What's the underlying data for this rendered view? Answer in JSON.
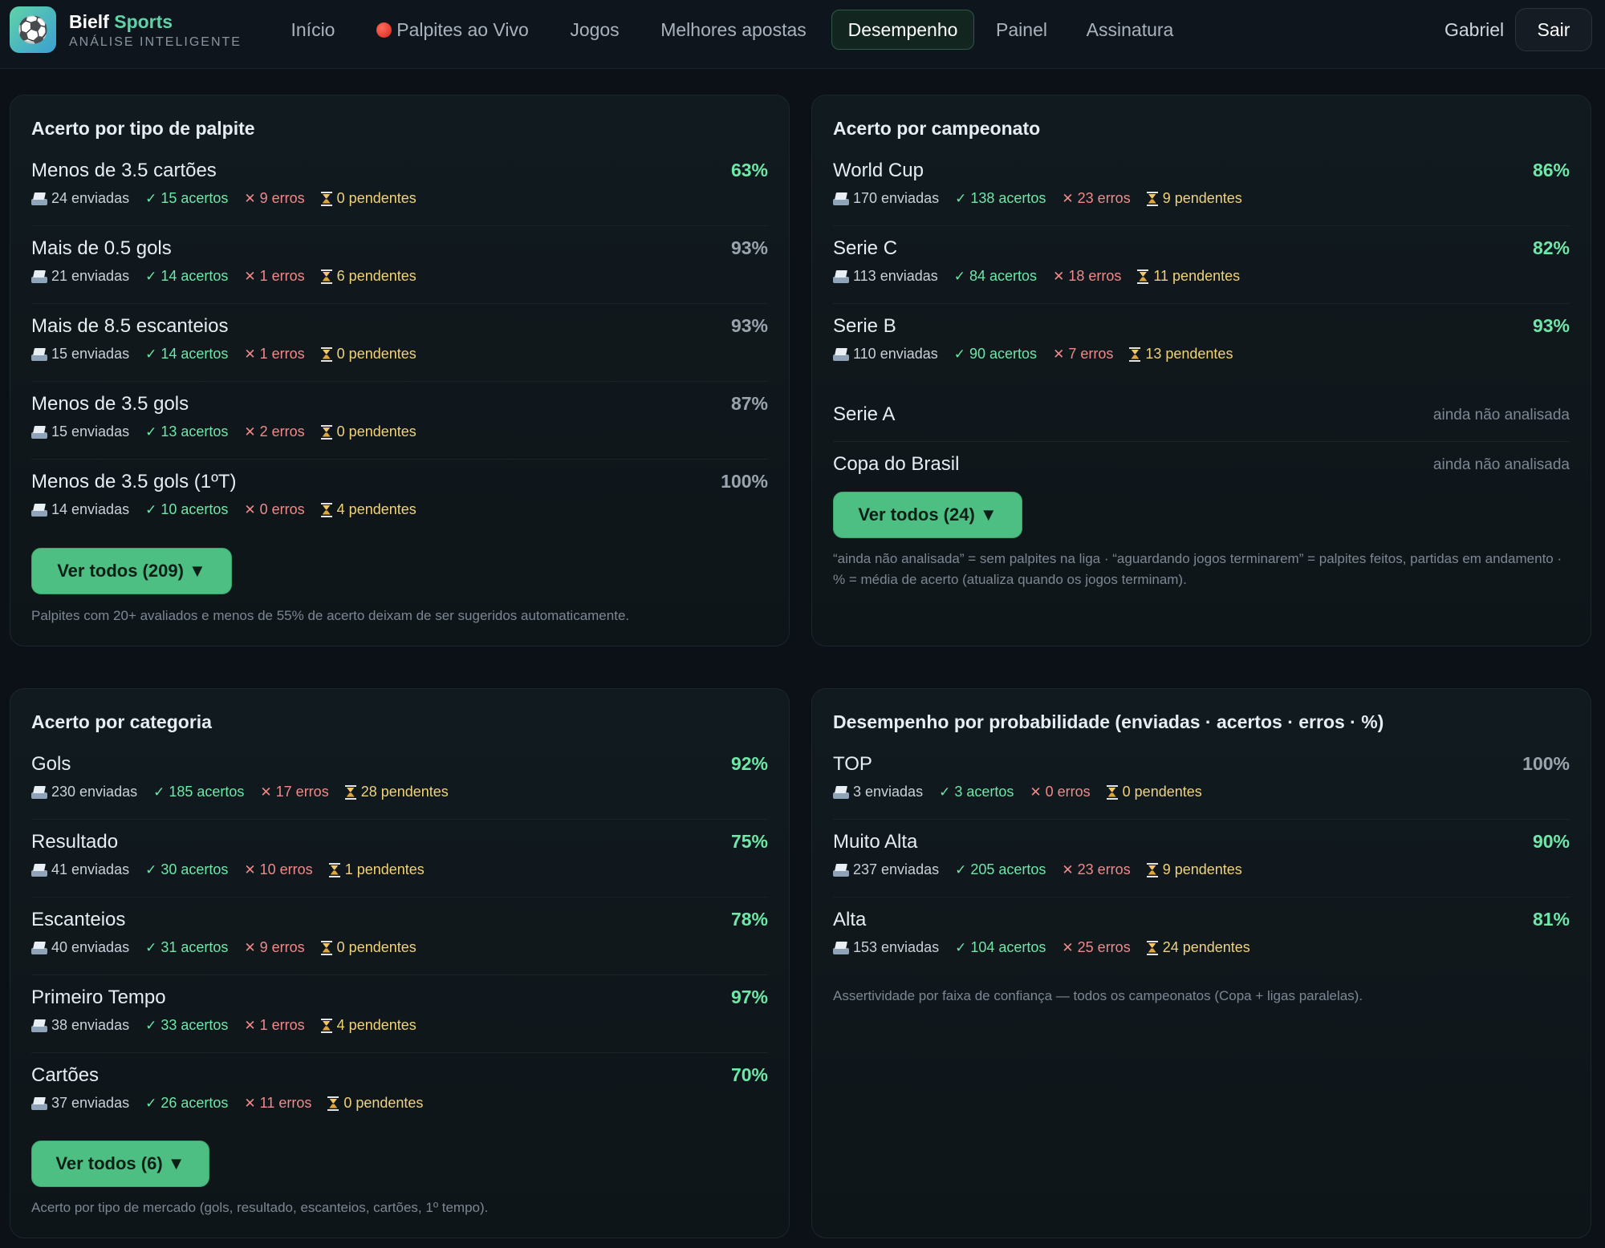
{
  "brand": {
    "logo_icon": "soccer-ball-icon",
    "name_part1": "Bielf",
    "name_part2": "Sports",
    "tagline": "ANÁLISE INTELIGENTE"
  },
  "nav": {
    "items": [
      {
        "label": "Início"
      },
      {
        "label": "Palpites ao Vivo",
        "icon": "live-red-dot-icon"
      },
      {
        "label": "Jogos"
      },
      {
        "label": "Melhores apostas"
      },
      {
        "label": "Desempenho",
        "active": true
      },
      {
        "label": "Painel"
      },
      {
        "label": "Assinatura"
      }
    ],
    "user": "Gabriel",
    "logout": "Sair"
  },
  "colors": {
    "accent_green": "#6ee7a8",
    "button_green": "#4ebf82",
    "miss_red": "#f08a8a",
    "pending_yellow": "#f0d27a",
    "background": "#0b1117"
  },
  "panels": {
    "tipo": {
      "title": "Acerto por tipo de palpite",
      "rows": [
        {
          "name": "Menos de 3.5 cartões",
          "pct": "63%",
          "sent": "24 enviadas",
          "hit": "15 acertos",
          "miss": "9 erros",
          "pend": "0 pendentes"
        },
        {
          "name": "Mais de 0.5 gols",
          "pct": "93%",
          "sent": "21 enviadas",
          "hit": "14 acertos",
          "miss": "1 erros",
          "pend": "6 pendentes"
        },
        {
          "name": "Mais de 8.5 escanteios",
          "pct": "93%",
          "sent": "15 enviadas",
          "hit": "14 acertos",
          "miss": "1 erros",
          "pend": "0 pendentes"
        },
        {
          "name": "Menos de 3.5 gols",
          "pct": "87%",
          "sent": "15 enviadas",
          "hit": "13 acertos",
          "miss": "2 erros",
          "pend": "0 pendentes"
        },
        {
          "name": "Menos de 3.5 gols (1ºT)",
          "pct": "100%",
          "sent": "14 enviadas",
          "hit": "10 acertos",
          "miss": "0 erros",
          "pend": "4 pendentes"
        }
      ],
      "button": "Ver todos (209) ▼",
      "note": "Palpites com 20+ avaliados e menos de 55% de acerto deixam de ser sugeridos automaticamente."
    },
    "campeonato": {
      "title": "Acerto por campeonato",
      "rows": [
        {
          "name": "World Cup",
          "pct": "86%",
          "sent": "170 enviadas",
          "hit": "138 acertos",
          "miss": "23 erros",
          "pend": "9 pendentes"
        },
        {
          "name": "Serie C",
          "pct": "82%",
          "sent": "113 enviadas",
          "hit": "84 acertos",
          "miss": "18 erros",
          "pend": "11 pendentes"
        },
        {
          "name": "Serie B",
          "pct": "93%",
          "sent": "110 enviadas",
          "hit": "90 acertos",
          "miss": "7 erros",
          "pend": "13 pendentes"
        }
      ],
      "unanalyzed": [
        {
          "name": "Serie A",
          "status": "ainda não analisada"
        },
        {
          "name": "Copa do Brasil",
          "status": "ainda não analisada"
        }
      ],
      "button": "Ver todos (24) ▼",
      "note": "“ainda não analisada” = sem palpites na liga · “aguardando jogos terminarem” = palpites feitos, partidas em andamento · % = média de acerto (atualiza quando os jogos terminam)."
    },
    "categoria": {
      "title": "Acerto por categoria",
      "rows": [
        {
          "name": "Gols",
          "pct": "92%",
          "sent": "230 enviadas",
          "hit": "185 acertos",
          "miss": "17 erros",
          "pend": "28 pendentes"
        },
        {
          "name": "Resultado",
          "pct": "75%",
          "sent": "41 enviadas",
          "hit": "30 acertos",
          "miss": "10 erros",
          "pend": "1 pendentes"
        },
        {
          "name": "Escanteios",
          "pct": "78%",
          "sent": "40 enviadas",
          "hit": "31 acertos",
          "miss": "9 erros",
          "pend": "0 pendentes"
        },
        {
          "name": "Primeiro Tempo",
          "pct": "97%",
          "sent": "38 enviadas",
          "hit": "33 acertos",
          "miss": "1 erros",
          "pend": "4 pendentes"
        },
        {
          "name": "Cartões",
          "pct": "70%",
          "sent": "37 enviadas",
          "hit": "26 acertos",
          "miss": "11 erros",
          "pend": "0 pendentes"
        }
      ],
      "button": "Ver todos (6) ▼",
      "note": "Acerto por tipo de mercado (gols, resultado, escanteios, cartões, 1º tempo)."
    },
    "probabilidade": {
      "title": "Desempenho por probabilidade (enviadas · acertos · erros · %)",
      "rows": [
        {
          "name": "TOP",
          "pct": "100%",
          "sent": "3 enviadas",
          "hit": "3 acertos",
          "miss": "0 erros",
          "pend": "0 pendentes"
        },
        {
          "name": "Muito Alta",
          "pct": "90%",
          "sent": "237 enviadas",
          "hit": "205 acertos",
          "miss": "23 erros",
          "pend": "9 pendentes"
        },
        {
          "name": "Alta",
          "pct": "81%",
          "sent": "153 enviadas",
          "hit": "104 acertos",
          "miss": "25 erros",
          "pend": "24 pendentes"
        }
      ],
      "note": "Assertividade por faixa de confiança — todos os campeonatos (Copa + ligas paralelas)."
    }
  }
}
